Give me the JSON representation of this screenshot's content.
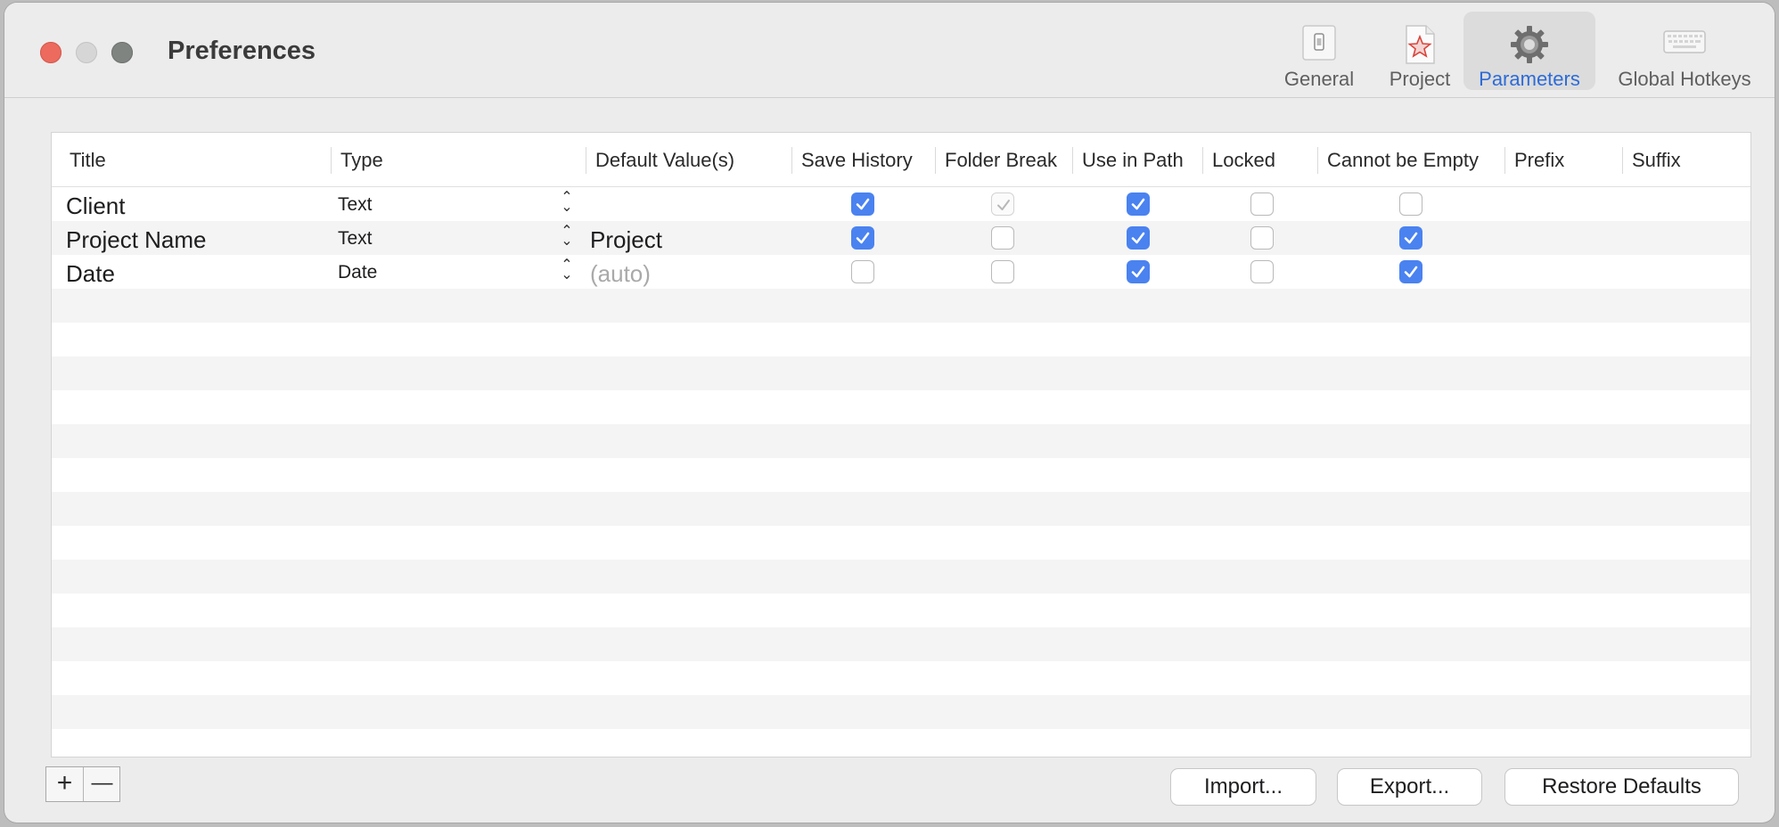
{
  "window": {
    "title": "Preferences"
  },
  "toolbar": {
    "items": [
      {
        "label": "General",
        "icon": "switch-icon",
        "active": false
      },
      {
        "label": "Project",
        "icon": "project-star-icon",
        "active": false
      },
      {
        "label": "Parameters",
        "icon": "gear-icon",
        "active": true
      },
      {
        "label": "Global Hotkeys",
        "icon": "keyboard-icon",
        "active": false
      }
    ]
  },
  "table": {
    "columns": [
      "Title",
      "Type",
      "Default Value(s)",
      "Save History",
      "Folder Break",
      "Use in Path",
      "Locked",
      "Cannot be Empty",
      "Prefix",
      "Suffix"
    ],
    "rows": [
      {
        "title": "Client",
        "type": "Text",
        "default": "",
        "save_history": true,
        "folder_break": "checked-disabled",
        "use_in_path": true,
        "locked": false,
        "cannot_be_empty": false
      },
      {
        "title": "Project Name",
        "type": "Text",
        "default": "Project",
        "save_history": true,
        "folder_break": false,
        "use_in_path": true,
        "locked": false,
        "cannot_be_empty": true
      },
      {
        "title": "Date",
        "type": "Date",
        "default_placeholder": "(auto)",
        "save_history": false,
        "folder_break": false,
        "use_in_path": true,
        "locked": false,
        "cannot_be_empty": true
      }
    ]
  },
  "footer": {
    "add_label": "+",
    "remove_label": "—",
    "import_label": "Import...",
    "export_label": "Export...",
    "restore_label": "Restore Defaults"
  },
  "colors": {
    "accent": "#4a82f0",
    "close": "#ec6a5e",
    "active_tab_text": "#2d6bd8"
  }
}
